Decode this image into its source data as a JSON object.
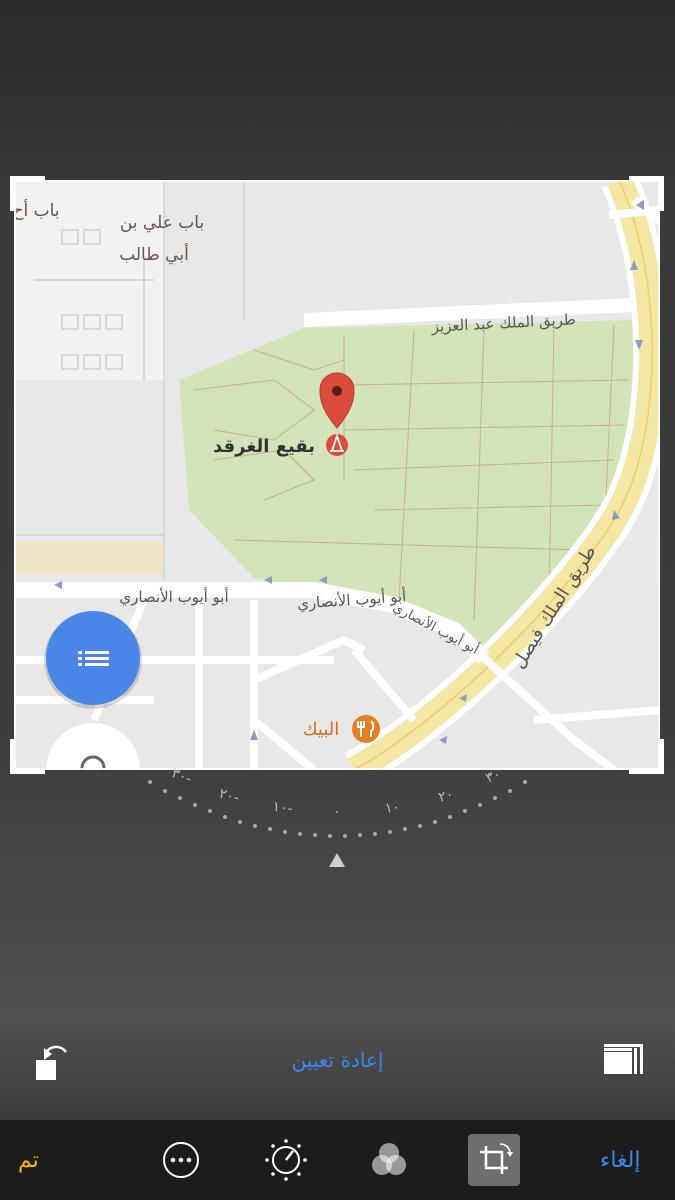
{
  "map": {
    "labels": {
      "gate_ali_line1": "باب علي بن",
      "gate_ali_line2": "أبي طالب",
      "gate_cut": "باب أح",
      "king_abdulaziz_road": "طريق الملك عبد العزيز",
      "baqi_cemetery": "بقيع الغرقد",
      "abu_ayyub_1": "أبو أيوب الأنصاري",
      "abu_ayyub_2": "أبو أيوب الأنصاري",
      "abu_ayyub_3": "أبو أيوب الأنصاري",
      "king_faisal_road": "طريق الملك فيصل",
      "albaik": "البيك"
    },
    "icons": {
      "pin": "location-pin-icon",
      "cemetery": "cemetery-icon",
      "restaurant": "restaurant-icon",
      "list": "list-icon",
      "compass": "compass-icon"
    },
    "colors": {
      "park": "#d3e4b8",
      "road": "#ffffff",
      "highway": "#f4e6a3",
      "fab": "#4a86e8",
      "pin": "#dd4b3e",
      "restaurant": "#e67e22"
    }
  },
  "dial": {
    "ticks": [
      "٣٠-",
      "٢٠-",
      "١٠-",
      "٠",
      "١٠",
      "٢٠",
      "٣٠"
    ]
  },
  "controls": {
    "reset_label": "إعادة تعيين",
    "rotate_icon": "rotate-icon",
    "aspect_icon": "aspect-ratio-icon"
  },
  "toolbar": {
    "done_label": "تم",
    "cancel_label": "إلغاء",
    "tools": [
      "more-icon",
      "adjust-dial-icon",
      "filters-icon",
      "crop-icon"
    ],
    "accent_done": "#f5b700",
    "accent_cancel": "#3d86f2"
  }
}
